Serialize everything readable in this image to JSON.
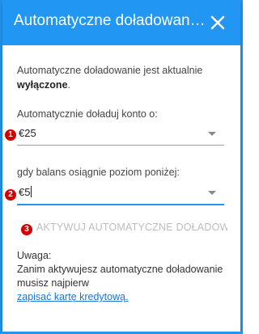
{
  "dialog": {
    "title": "Automatyczne doładowanie jest aktualnie wyłączone",
    "header_title": "Automatyczne doładowanie…"
  },
  "status": {
    "text": "Automatyczne doładowanie jest aktualnie",
    "state": "wyłączone",
    "suffix": "."
  },
  "topup": {
    "label": "Automatycznie doładuj konto o:",
    "value": "€25"
  },
  "threshold": {
    "label": "gdy balans osiągnie poziom poniżej:",
    "value": "€5"
  },
  "activate": {
    "label": "AKTYWUJ AUTOMATYCZNE DOŁADOWANIE"
  },
  "note": {
    "heading": "Uwaga:",
    "text": "Zanim aktywujesz automatyczne doładowanie musisz najpierw",
    "link": "zapisać kartę kredytową."
  },
  "badges": [
    "1",
    "2",
    "3"
  ],
  "colors": {
    "primary": "#2196f3",
    "badge": "#d50000",
    "link": "#1976d2",
    "disabled": "#bdbdbd"
  },
  "icons": {
    "close": "close-icon",
    "dropdown": "chevron-down-icon"
  }
}
